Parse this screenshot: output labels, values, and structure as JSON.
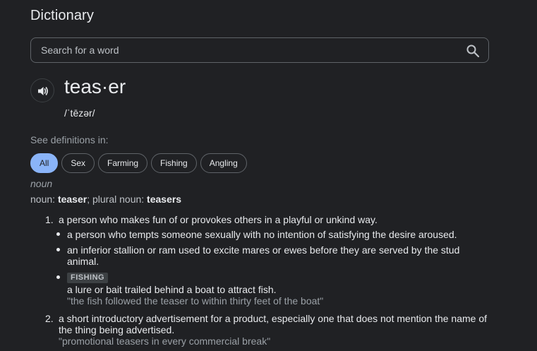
{
  "title": "Dictionary",
  "search": {
    "placeholder": "Search for a word"
  },
  "entry": {
    "headword": "teas·er",
    "phonetic": "/ˈtēzər/"
  },
  "see_definitions_label": "See definitions in:",
  "chips": [
    "All",
    "Sex",
    "Farming",
    "Fishing",
    "Angling"
  ],
  "part_of_speech": "noun",
  "forms": {
    "noun_label": "noun",
    "noun_value": "teaser",
    "plural_label": "plural noun",
    "plural_value": "teasers"
  },
  "definitions": [
    {
      "number": "1.",
      "text": "a person who makes fun of or provokes others in a playful or unkind way.",
      "subs": [
        {
          "text": "a person who tempts someone sexually with no intention of satisfying the desire aroused."
        },
        {
          "text_line1": "an inferior stallion or ram used to excite mares or ewes before they are served by the stud",
          "text_line2": "animal."
        },
        {
          "tag": "FISHING",
          "text": "a lure or bait trailed behind a boat to attract fish.",
          "example": "\"the fish followed the teaser to within thirty feet of the boat\""
        }
      ]
    },
    {
      "number": "2.",
      "text_line1": "a short introductory advertisement for a product, especially one that does not mention the name of",
      "text_line2": "the thing being advertised.",
      "example": "\"promotional teasers in every commercial break\""
    }
  ]
}
